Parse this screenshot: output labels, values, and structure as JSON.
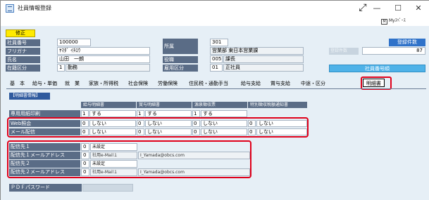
{
  "window": {
    "title": "社員情報登録"
  },
  "toolbar": {
    "mypage_label": "Myｽﾍﾟｰｽ",
    "mypage_icon": "mypage-icon"
  },
  "status": {
    "mode_badge": "修正"
  },
  "employee": {
    "labels": [
      "社員番号",
      "フリガナ",
      "氏名",
      "在籍区分"
    ],
    "number": "100000",
    "kana": "ﾔﾏﾀﾞ ｲﾁﾛｳ",
    "name": "山田　一朗",
    "status_code": "1",
    "status_name": "勤務"
  },
  "dept": {
    "labels": [
      "所属",
      "役職",
      "雇用区分"
    ],
    "code": "301",
    "name": "営業部 東日本営業課",
    "post_code": "005",
    "post_name": "課長",
    "emp_code": "01",
    "emp_name": "正社員"
  },
  "count": {
    "ghost_label": "登録件数",
    "label": "登録件数",
    "value": "87",
    "order": "社員番号順"
  },
  "tabs": [
    "基　本",
    "給与・単価",
    "就　業",
    "家族・所得税",
    "社会保険",
    "労働保険",
    "住民税・通勤手当",
    "給与支給",
    "賞与支給",
    "中途・区分",
    "明細書"
  ],
  "panel": {
    "title": "【明細書情報】",
    "columns": [
      "給与明細書",
      "賞与明細書",
      "源泉徴収票",
      "特別徴収税額通知書"
    ],
    "rows": [
      {
        "label": "専用用紙印刷",
        "cells": [
          [
            "1",
            "する"
          ],
          [
            "1",
            "する"
          ],
          [
            "1",
            "する"
          ]
        ]
      },
      {
        "label": "Web照会",
        "cells": [
          [
            "0",
            "しない"
          ],
          [
            "0",
            "しない"
          ],
          [
            "0",
            "しない"
          ],
          [
            "0",
            "しない"
          ]
        ]
      },
      {
        "label": "メール配信",
        "cells": [
          [
            "0",
            "しない"
          ],
          [
            "0",
            "しない"
          ],
          [
            "0",
            "しない"
          ],
          [
            "0",
            "しない"
          ]
        ]
      }
    ],
    "delivery": [
      {
        "label": "配信先１",
        "code": "0",
        "value": "未設定"
      },
      {
        "label": "配信先１メールアドレス",
        "code": "0",
        "value": "社用e-Mail１",
        "address": "I_Yamada@obcs.com"
      },
      {
        "label": "配信先２",
        "code": "0",
        "value": "未設定"
      },
      {
        "label": "配信先２メールアドレス",
        "code": "0",
        "value": "社用e-Mail１",
        "address": "I_Yamada@obcs.com"
      }
    ],
    "pdf_label": "ＰＤＦパスワード"
  },
  "colors": {
    "accent": "#e0001a",
    "label_bg": "#5a6c86",
    "mode_badge": "#ffea00",
    "panel_bg": "#e6eff6"
  }
}
